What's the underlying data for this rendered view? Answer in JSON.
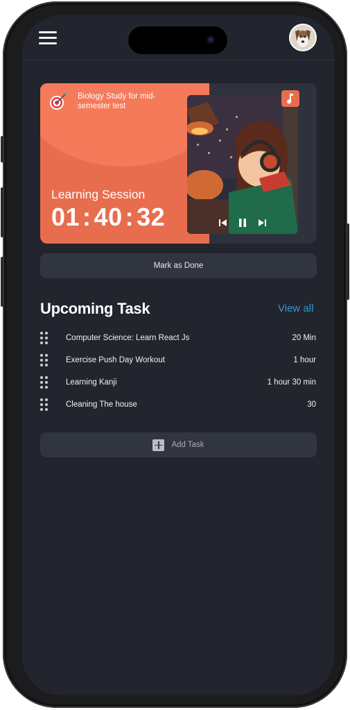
{
  "header": {
    "menu_icon": "hamburger-menu-icon",
    "avatar_icon": "dog-avatar"
  },
  "session": {
    "task_name": "Biology Study for mid-semester test",
    "label": "Learning Session",
    "timer": {
      "hours": "01",
      "minutes": "40",
      "seconds": "32",
      "separator": ":"
    },
    "accent_color": "#e86d4e",
    "music_icon": "music-note-icon",
    "controls": [
      "skip-previous-icon",
      "pause-icon",
      "skip-next-icon"
    ]
  },
  "mark_done_label": "Mark as Done",
  "upcoming": {
    "title": "Upcoming Task",
    "view_all_label": "View all",
    "link_color": "#2e9ad0",
    "tasks": [
      {
        "title": "Computer Science: Learn React Js",
        "duration": "20 Min"
      },
      {
        "title": "Exercise Push Day Workout",
        "duration": "1 hour"
      },
      {
        "title": "Learning Kanji",
        "duration": "1 hour 30 min"
      },
      {
        "title": "Cleaning The house",
        "duration": "30"
      }
    ]
  },
  "add_task_label": "Add Task"
}
